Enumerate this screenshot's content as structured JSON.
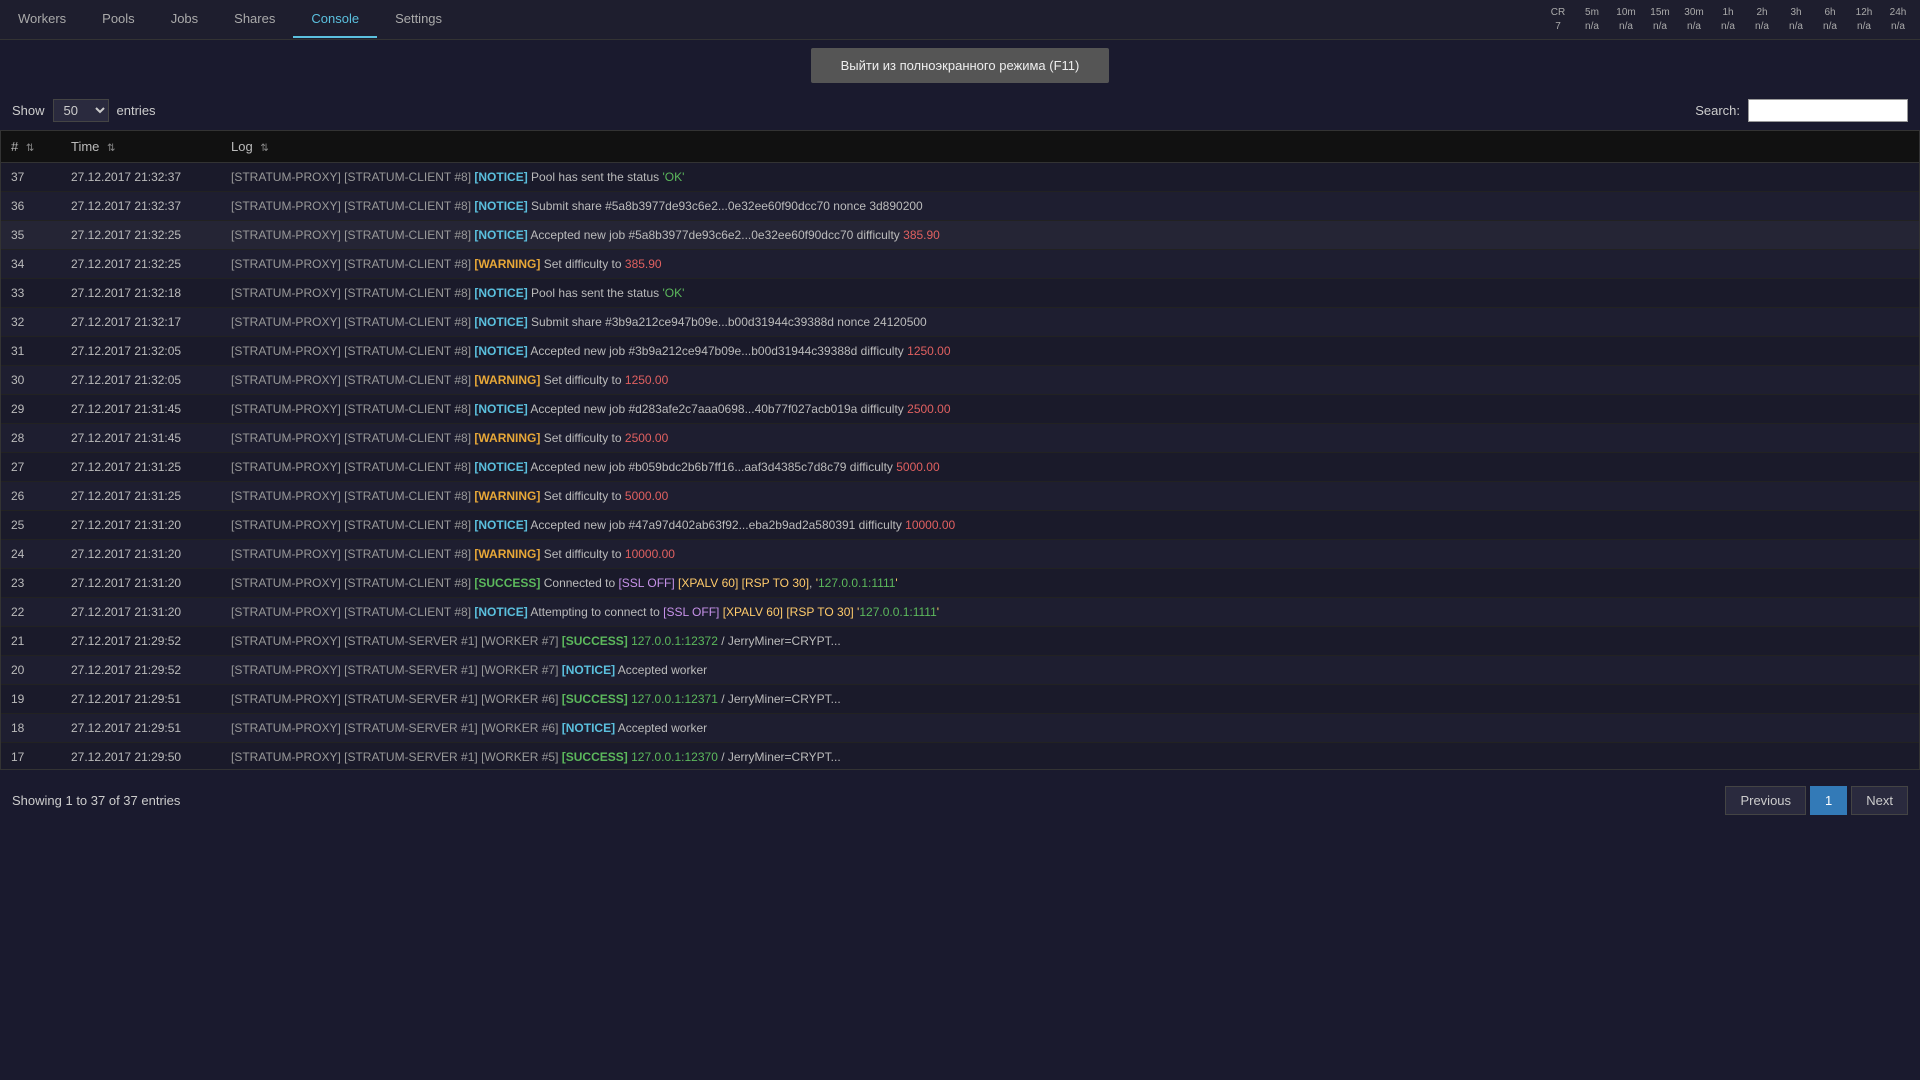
{
  "nav": {
    "tabs": [
      {
        "label": "Workers",
        "active": false
      },
      {
        "label": "Pools",
        "active": false
      },
      {
        "label": "Jobs",
        "active": false
      },
      {
        "label": "Shares",
        "active": false
      },
      {
        "label": "Console",
        "active": true
      },
      {
        "label": "Settings",
        "active": false
      }
    ]
  },
  "stats": {
    "headers": [
      "CR",
      "5m",
      "10m",
      "15m",
      "30m",
      "1h",
      "2h",
      "3h",
      "6h",
      "12h",
      "24h"
    ],
    "values": [
      "7",
      "n/a",
      "n/a",
      "n/a",
      "n/a",
      "n/a",
      "n/a",
      "n/a",
      "n/a",
      "n/a",
      "n/a"
    ]
  },
  "fullscreen_btn": "Выйти из полноэкранного режима (F11)",
  "show_label": "Show",
  "entries_label": "entries",
  "entries_value": "50",
  "search_label": "Search:",
  "table": {
    "columns": [
      "#",
      "Time",
      "Log"
    ],
    "rows": [
      {
        "num": "37",
        "time": "27.12.2017 21:32:37",
        "log": "[STRATUM-PROXY] [STRATUM-CLIENT #8] [NOTICE] Pool has sent the status 'OK'",
        "type": "notice"
      },
      {
        "num": "36",
        "time": "27.12.2017 21:32:37",
        "log": "[STRATUM-PROXY] [STRATUM-CLIENT #8] [NOTICE] Submit share #5a8b3977de93c6e2...0e32ee60f90dcc70 nonce 3d890200",
        "type": "notice"
      },
      {
        "num": "35",
        "time": "27.12.2017 21:32:25",
        "log": "[STRATUM-PROXY] [STRATUM-CLIENT #8] [NOTICE] Accepted new job #5a8b3977de93c6e2...0e32ee60f90dcc70 difficulty 385.90",
        "type": "notice",
        "highlight": true
      },
      {
        "num": "34",
        "time": "27.12.2017 21:32:25",
        "log": "[STRATUM-PROXY] [STRATUM-CLIENT #8] [WARNING] Set difficulty to 385.90",
        "type": "warning"
      },
      {
        "num": "33",
        "time": "27.12.2017 21:32:18",
        "log": "[STRATUM-PROXY] [STRATUM-CLIENT #8] [NOTICE] Pool has sent the status 'OK'",
        "type": "notice"
      },
      {
        "num": "32",
        "time": "27.12.2017 21:32:17",
        "log": "[STRATUM-PROXY] [STRATUM-CLIENT #8] [NOTICE] Submit share #3b9a212ce947b09e...b00d31944c39388d nonce 24120500",
        "type": "notice"
      },
      {
        "num": "31",
        "time": "27.12.2017 21:32:05",
        "log": "[STRATUM-PROXY] [STRATUM-CLIENT #8] [NOTICE] Accepted new job #3b9a212ce947b09e...b00d31944c39388d difficulty 1250.00",
        "type": "notice"
      },
      {
        "num": "30",
        "time": "27.12.2017 21:32:05",
        "log": "[STRATUM-PROXY] [STRATUM-CLIENT #8] [WARNING] Set difficulty to 1250.00",
        "type": "warning"
      },
      {
        "num": "29",
        "time": "27.12.2017 21:31:45",
        "log": "[STRATUM-PROXY] [STRATUM-CLIENT #8] [NOTICE] Accepted new job #d283afe2c7aaa0698...40b77f027acb019a difficulty 2500.00",
        "type": "notice"
      },
      {
        "num": "28",
        "time": "27.12.2017 21:31:45",
        "log": "[STRATUM-PROXY] [STRATUM-CLIENT #8] [WARNING] Set difficulty to 2500.00",
        "type": "warning"
      },
      {
        "num": "27",
        "time": "27.12.2017 21:31:25",
        "log": "[STRATUM-PROXY] [STRATUM-CLIENT #8] [NOTICE] Accepted new job #b059bdc2b6b7ff16...aaf3d4385c7d8c79 difficulty 5000.00",
        "type": "notice"
      },
      {
        "num": "26",
        "time": "27.12.2017 21:31:25",
        "log": "[STRATUM-PROXY] [STRATUM-CLIENT #8] [WARNING] Set difficulty to 5000.00",
        "type": "warning"
      },
      {
        "num": "25",
        "time": "27.12.2017 21:31:20",
        "log": "[STRATUM-PROXY] [STRATUM-CLIENT #8] [NOTICE] Accepted new job #47a97d402ab63f92...eba2b9ad2a580391 difficulty 10000.00",
        "type": "notice"
      },
      {
        "num": "24",
        "time": "27.12.2017 21:31:20",
        "log": "[STRATUM-PROXY] [STRATUM-CLIENT #8] [WARNING] Set difficulty to 10000.00",
        "type": "warning"
      },
      {
        "num": "23",
        "time": "27.12.2017 21:31:20",
        "log": "[STRATUM-PROXY] [STRATUM-CLIENT #8] [SUCCESS] Connected to [SSL OFF] [XPALV 60] [RSP TO 30], '127.0.0.1:1111'",
        "type": "success"
      },
      {
        "num": "22",
        "time": "27.12.2017 21:31:20",
        "log": "[STRATUM-PROXY] [STRATUM-CLIENT #8] [NOTICE] Attempting to connect to [SSL OFF] [XPALV 60] [RSP TO 30] '127.0.0.1:1111'",
        "type": "notice"
      },
      {
        "num": "21",
        "time": "27.12.2017 21:29:52",
        "log": "[STRATUM-PROXY] [STRATUM-SERVER #1] [WORKER #7] [SUCCESS] 127.0.0.1:12372 / JerryMiner=CRYPT...",
        "type": "success"
      },
      {
        "num": "20",
        "time": "27.12.2017 21:29:52",
        "log": "[STRATUM-PROXY] [STRATUM-SERVER #1] [WORKER #7] [NOTICE] Accepted worker",
        "type": "notice"
      },
      {
        "num": "19",
        "time": "27.12.2017 21:29:51",
        "log": "[STRATUM-PROXY] [STRATUM-SERVER #1] [WORKER #6] [SUCCESS] 127.0.0.1:12371 / JerryMiner=CRYPT...",
        "type": "success"
      },
      {
        "num": "18",
        "time": "27.12.2017 21:29:51",
        "log": "[STRATUM-PROXY] [STRATUM-SERVER #1] [WORKER #6] [NOTICE] Accepted worker",
        "type": "notice"
      },
      {
        "num": "17",
        "time": "27.12.2017 21:29:50",
        "log": "[STRATUM-PROXY] [STRATUM-SERVER #1] [WORKER #5] [SUCCESS] 127.0.0.1:12370 / JerryMiner=CRYPT...",
        "type": "success"
      }
    ]
  },
  "footer": {
    "info": "Showing 1 to 37 of 37 entries",
    "previous": "Previous",
    "next": "Next",
    "current_page": "1"
  }
}
